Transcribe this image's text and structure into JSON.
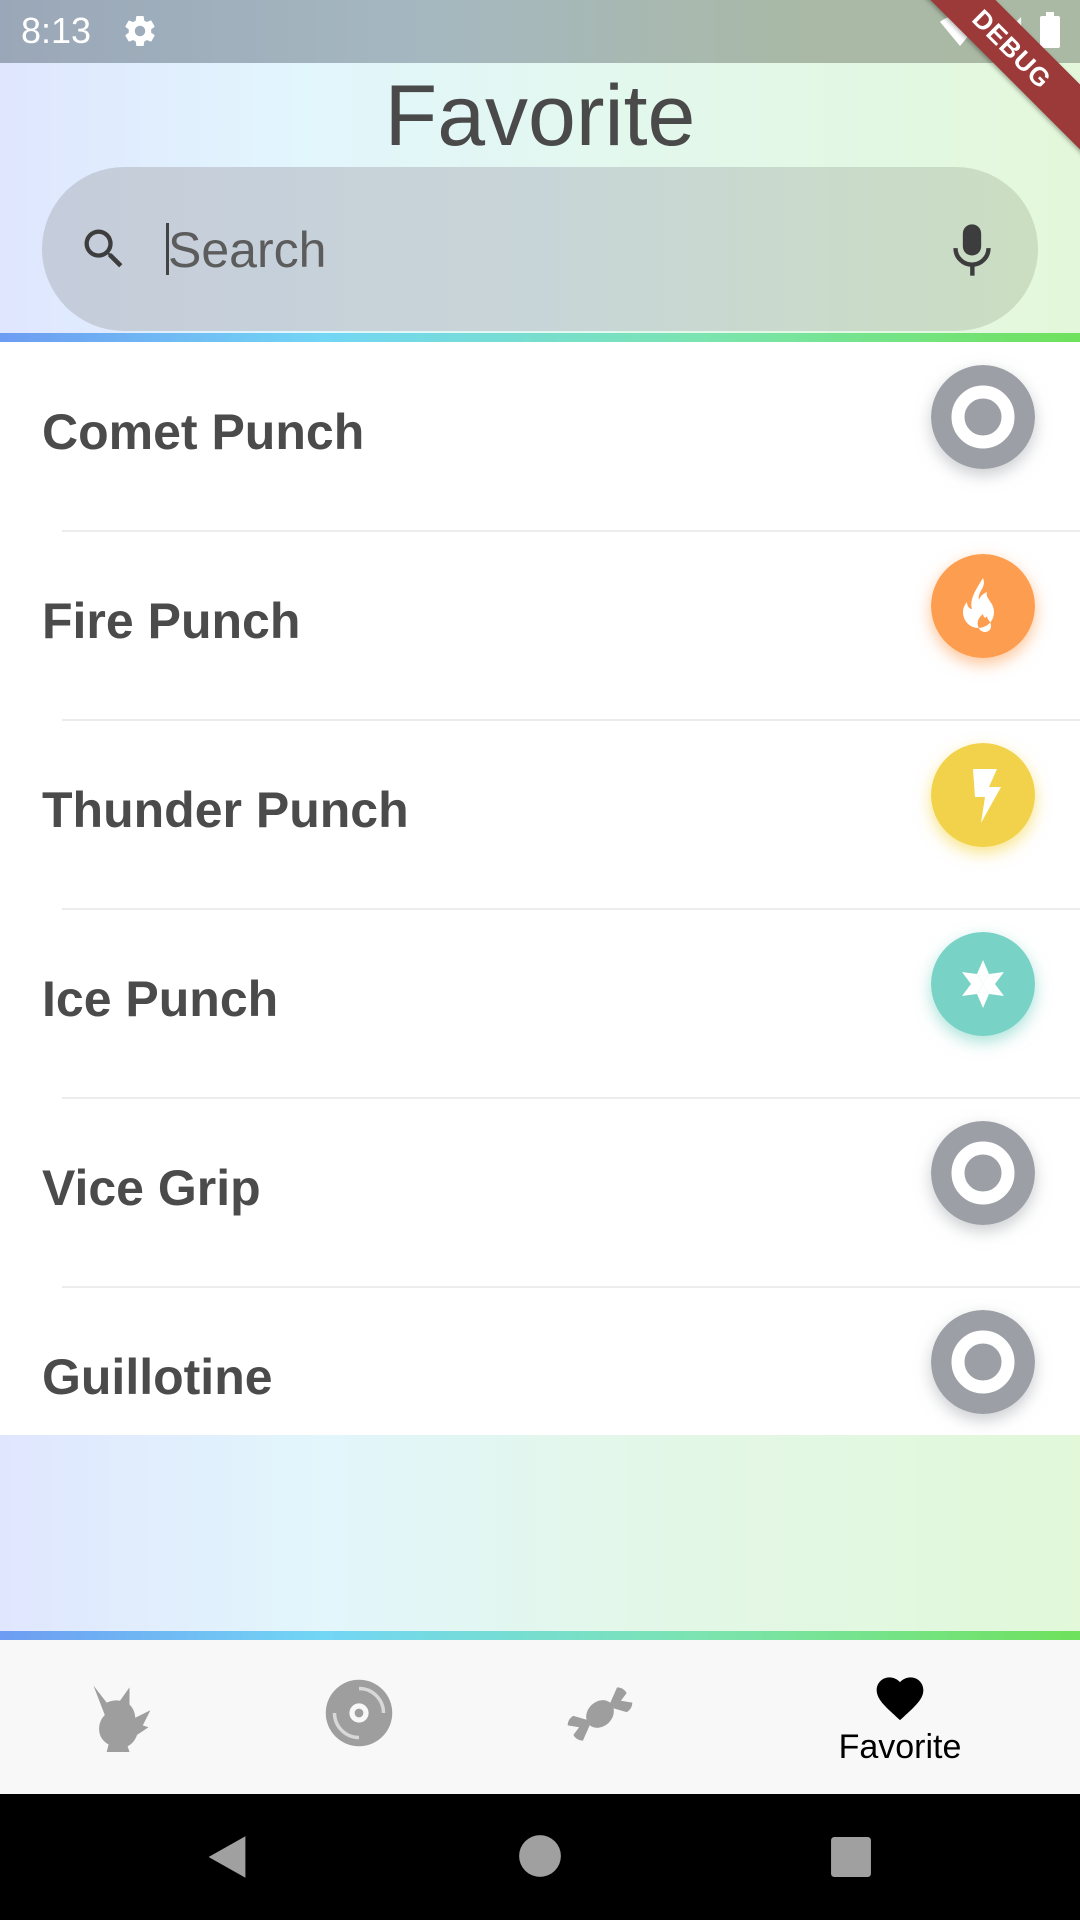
{
  "status_bar": {
    "time": "8:13",
    "debug_label": "DEBUG"
  },
  "page": {
    "title": "Favorite"
  },
  "search": {
    "placeholder": "Search",
    "value": ""
  },
  "moves": [
    {
      "name": "Comet Punch",
      "type": "normal",
      "icon": "target-icon",
      "color": "#9fa2a7"
    },
    {
      "name": "Fire Punch",
      "type": "fire",
      "icon": "flame-icon",
      "color": "#fd9d54"
    },
    {
      "name": "Thunder Punch",
      "type": "electric",
      "icon": "lightning-icon",
      "color": "#f4d23c"
    },
    {
      "name": "Ice Punch",
      "type": "ice",
      "icon": "snowflake-icon",
      "color": "#73cec0"
    },
    {
      "name": "Vice Grip",
      "type": "normal",
      "icon": "target-icon",
      "color": "#9fa2a7"
    },
    {
      "name": "Guillotine",
      "type": "normal",
      "icon": "target-icon",
      "color": "#9fa2a7"
    }
  ],
  "bottom_nav": {
    "items": [
      {
        "id": "pokemon",
        "icon": "pikachu-icon",
        "label": ""
      },
      {
        "id": "moves",
        "icon": "disc-icon",
        "label": ""
      },
      {
        "id": "items",
        "icon": "candy-icon",
        "label": ""
      },
      {
        "id": "favorite",
        "icon": "heart-icon",
        "label": "Favorite",
        "active": true
      }
    ]
  },
  "colors": {
    "accent_active": "#000000",
    "nav_inactive": "#9e9e9e"
  }
}
